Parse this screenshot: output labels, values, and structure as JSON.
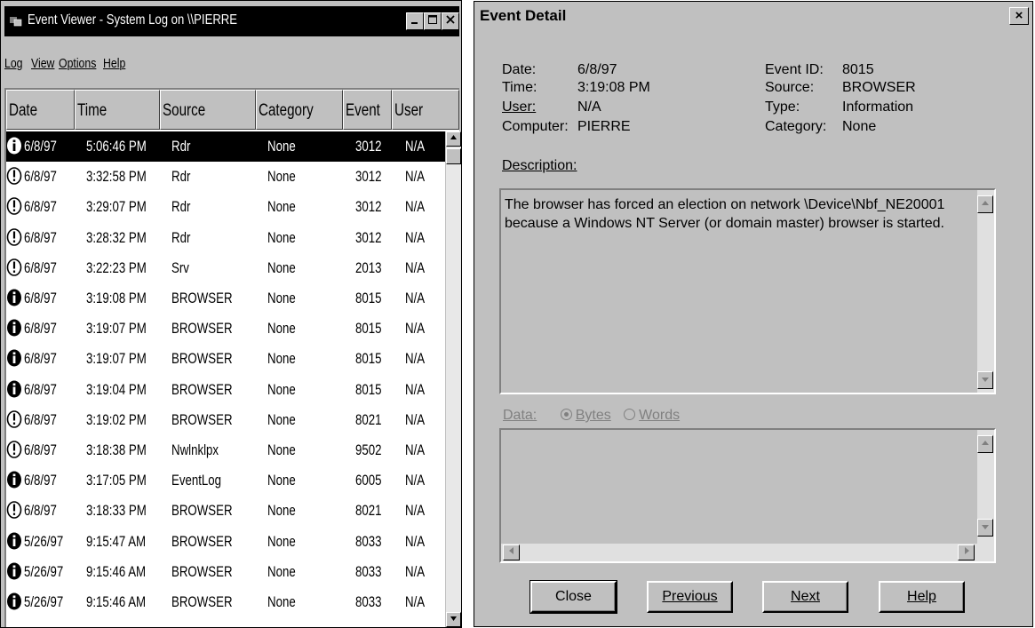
{
  "event_viewer": {
    "title": "Event Viewer - System Log on \\\\PIERRE",
    "menu": [
      "Log",
      "View",
      "Options",
      "Help"
    ],
    "columns": [
      "Date",
      "Time",
      "Source",
      "Category",
      "Event",
      "User"
    ],
    "rows": [
      {
        "icon": "info",
        "date": "6/8/97",
        "time": "5:06:46 PM",
        "source": "Rdr",
        "category": "None",
        "event": "3012",
        "user": "N/A",
        "selected": true
      },
      {
        "icon": "warning",
        "date": "6/8/97",
        "time": "3:32:58 PM",
        "source": "Rdr",
        "category": "None",
        "event": "3012",
        "user": "N/A"
      },
      {
        "icon": "warning",
        "date": "6/8/97",
        "time": "3:29:07 PM",
        "source": "Rdr",
        "category": "None",
        "event": "3012",
        "user": "N/A"
      },
      {
        "icon": "warning",
        "date": "6/8/97",
        "time": "3:28:32 PM",
        "source": "Rdr",
        "category": "None",
        "event": "3012",
        "user": "N/A"
      },
      {
        "icon": "warning",
        "date": "6/8/97",
        "time": "3:22:23 PM",
        "source": "Srv",
        "category": "None",
        "event": "2013",
        "user": "N/A"
      },
      {
        "icon": "info",
        "date": "6/8/97",
        "time": "3:19:08 PM",
        "source": "BROWSER",
        "category": "None",
        "event": "8015",
        "user": "N/A"
      },
      {
        "icon": "info",
        "date": "6/8/97",
        "time": "3:19:07 PM",
        "source": "BROWSER",
        "category": "None",
        "event": "8015",
        "user": "N/A"
      },
      {
        "icon": "info",
        "date": "6/8/97",
        "time": "3:19:07 PM",
        "source": "BROWSER",
        "category": "None",
        "event": "8015",
        "user": "N/A"
      },
      {
        "icon": "info",
        "date": "6/8/97",
        "time": "3:19:04 PM",
        "source": "BROWSER",
        "category": "None",
        "event": "8015",
        "user": "N/A"
      },
      {
        "icon": "warning",
        "date": "6/8/97",
        "time": "3:19:02 PM",
        "source": "BROWSER",
        "category": "None",
        "event": "8021",
        "user": "N/A"
      },
      {
        "icon": "warning",
        "date": "6/8/97",
        "time": "3:18:38 PM",
        "source": "Nwlnklpx",
        "category": "None",
        "event": "9502",
        "user": "N/A"
      },
      {
        "icon": "info",
        "date": "6/8/97",
        "time": "3:17:05 PM",
        "source": "EventLog",
        "category": "None",
        "event": "6005",
        "user": "N/A"
      },
      {
        "icon": "warning",
        "date": "6/8/97",
        "time": "3:18:33 PM",
        "source": "BROWSER",
        "category": "None",
        "event": "8021",
        "user": "N/A"
      },
      {
        "icon": "info",
        "date": "5/26/97",
        "time": "9:15:47 AM",
        "source": "BROWSER",
        "category": "None",
        "event": "8033",
        "user": "N/A"
      },
      {
        "icon": "info",
        "date": "5/26/97",
        "time": "9:15:46 AM",
        "source": "BROWSER",
        "category": "None",
        "event": "8033",
        "user": "N/A"
      },
      {
        "icon": "info",
        "date": "5/26/97",
        "time": "9:15:46 AM",
        "source": "BROWSER",
        "category": "None",
        "event": "8033",
        "user": "N/A"
      }
    ]
  },
  "event_detail": {
    "title": "Event Detail",
    "close_glyph": "×",
    "fields": {
      "date_label": "Date:",
      "date": "6/8/97",
      "time_label": "Time:",
      "time": "3:19:08 PM",
      "user_label": "User:",
      "user": "N/A",
      "computer_label": "Computer:",
      "computer": "PIERRE",
      "event_id_label": "Event ID:",
      "event_id": "8015",
      "source_label": "Source:",
      "source": "BROWSER",
      "type_label": "Type:",
      "type": "Information",
      "category_label": "Category:",
      "category": "None"
    },
    "description_label": "Description:",
    "description": "The browser has forced an election on network \\Device\\Nbf_NE20001 because a Windows NT Server (or domain master) browser is started.",
    "data_label": "Data:",
    "radio_bytes": "Bytes",
    "radio_words": "Words",
    "buttons": {
      "close": "Close",
      "previous": "Previous",
      "next": "Next",
      "help": "Help"
    }
  }
}
